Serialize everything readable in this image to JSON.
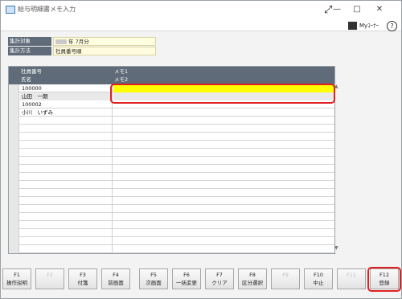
{
  "window": {
    "title": "給与明細書メモ入力",
    "minimize": "—",
    "maximize": "□",
    "close": "✕"
  },
  "topbar": {
    "expand_icon": "⤢",
    "my_label": "Myｺｰﾅｰ",
    "help_icon": "?"
  },
  "info": [
    {
      "label": "集計対象",
      "value": "年 7月分"
    },
    {
      "label": "集計方法",
      "value": "社員番号順"
    }
  ],
  "grid": {
    "headers": {
      "col1_top": "社員番号",
      "col1_bottom": "氏名",
      "col2_top": "メモ1",
      "col2_bottom": "メモ2"
    },
    "rows": [
      {
        "c1": "100000",
        "gray": false,
        "yellow": true
      },
      {
        "c1": "山田　一朗",
        "gray": true,
        "yellow": false
      },
      {
        "c1": "100002",
        "gray": false,
        "yellow": false
      },
      {
        "c1": "小川　いずみ",
        "gray": false,
        "yellow": false
      },
      {
        "c1": "",
        "gray": false,
        "yellow": false
      },
      {
        "c1": "",
        "gray": false,
        "yellow": false
      },
      {
        "c1": "",
        "gray": false,
        "yellow": false
      },
      {
        "c1": "",
        "gray": false,
        "yellow": false
      },
      {
        "c1": "",
        "gray": false,
        "yellow": false
      },
      {
        "c1": "",
        "gray": false,
        "yellow": false
      },
      {
        "c1": "",
        "gray": false,
        "yellow": false
      },
      {
        "c1": "",
        "gray": false,
        "yellow": false
      },
      {
        "c1": "",
        "gray": false,
        "yellow": false
      },
      {
        "c1": "",
        "gray": false,
        "yellow": false
      },
      {
        "c1": "",
        "gray": false,
        "yellow": false
      },
      {
        "c1": "",
        "gray": false,
        "yellow": false
      },
      {
        "c1": "",
        "gray": false,
        "yellow": false
      },
      {
        "c1": "",
        "gray": false,
        "yellow": false
      },
      {
        "c1": "",
        "gray": false,
        "yellow": false
      },
      {
        "c1": "",
        "gray": false,
        "yellow": false
      },
      {
        "c1": "",
        "gray": false,
        "yellow": false
      }
    ]
  },
  "scroll": {
    "up": "▲",
    "down": "▼"
  },
  "fkeys": [
    {
      "key": "F1",
      "label": "操作説明",
      "enabled": true
    },
    {
      "key": "F2",
      "label": "",
      "enabled": false
    },
    {
      "key": "F3",
      "label": "付箋",
      "enabled": true
    },
    {
      "key": "F4",
      "label": "前画面",
      "enabled": true
    },
    {
      "key": "F5",
      "label": "次画面",
      "enabled": true
    },
    {
      "key": "F6",
      "label": "一括変更",
      "enabled": true
    },
    {
      "key": "F7",
      "label": "クリア",
      "enabled": true
    },
    {
      "key": "F8",
      "label": "区分選択",
      "enabled": true
    },
    {
      "key": "F9",
      "label": "",
      "enabled": false
    },
    {
      "key": "F10",
      "label": "中止",
      "enabled": true
    },
    {
      "key": "F11",
      "label": "",
      "enabled": false
    },
    {
      "key": "F12",
      "label": "登録",
      "enabled": true
    }
  ],
  "colors": {
    "highlight": "#e02020",
    "header": "#5f6b78",
    "memo_active": "#ffff00"
  }
}
